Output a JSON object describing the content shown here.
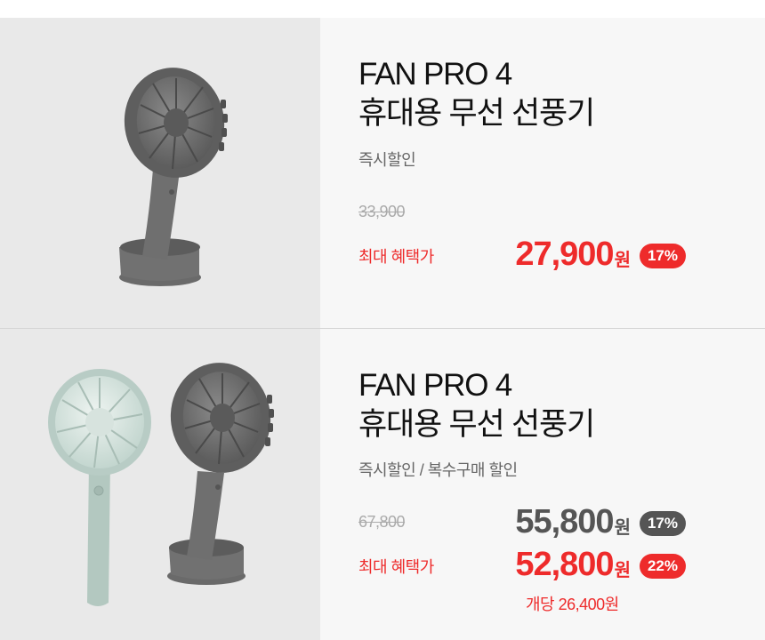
{
  "products": [
    {
      "title_line1": "FAN PRO 4",
      "title_line2": "휴대용 무선 선풍기",
      "discount_type": "즉시할인",
      "original_price": "33,900",
      "benefit_label": "최대 혜택가",
      "final_price": "27,900",
      "currency": "원",
      "discount_badge": "17%"
    },
    {
      "title_line1": "FAN PRO 4",
      "title_line2": "휴대용 무선 선풍기",
      "discount_type": "즉시할인 / 복수구매 할인",
      "original_price": "67,800",
      "sale_price": "55,800",
      "sale_currency": "원",
      "sale_badge": "17%",
      "benefit_label": "최대 혜택가",
      "final_price": "52,800",
      "currency": "원",
      "discount_badge": "22%",
      "per_unit": "개당 26,400원"
    }
  ],
  "colors": {
    "accent_red": "#ee2b2b",
    "badge_gray": "#555555",
    "fan_gray": "#6e6e6e",
    "fan_mint": "#b9cdc6",
    "panel_bg": "#e9e9e9",
    "card_bg": "#f7f7f7"
  },
  "icons": [
    "fan-gray-product-image",
    "fan-mint-product-image"
  ]
}
